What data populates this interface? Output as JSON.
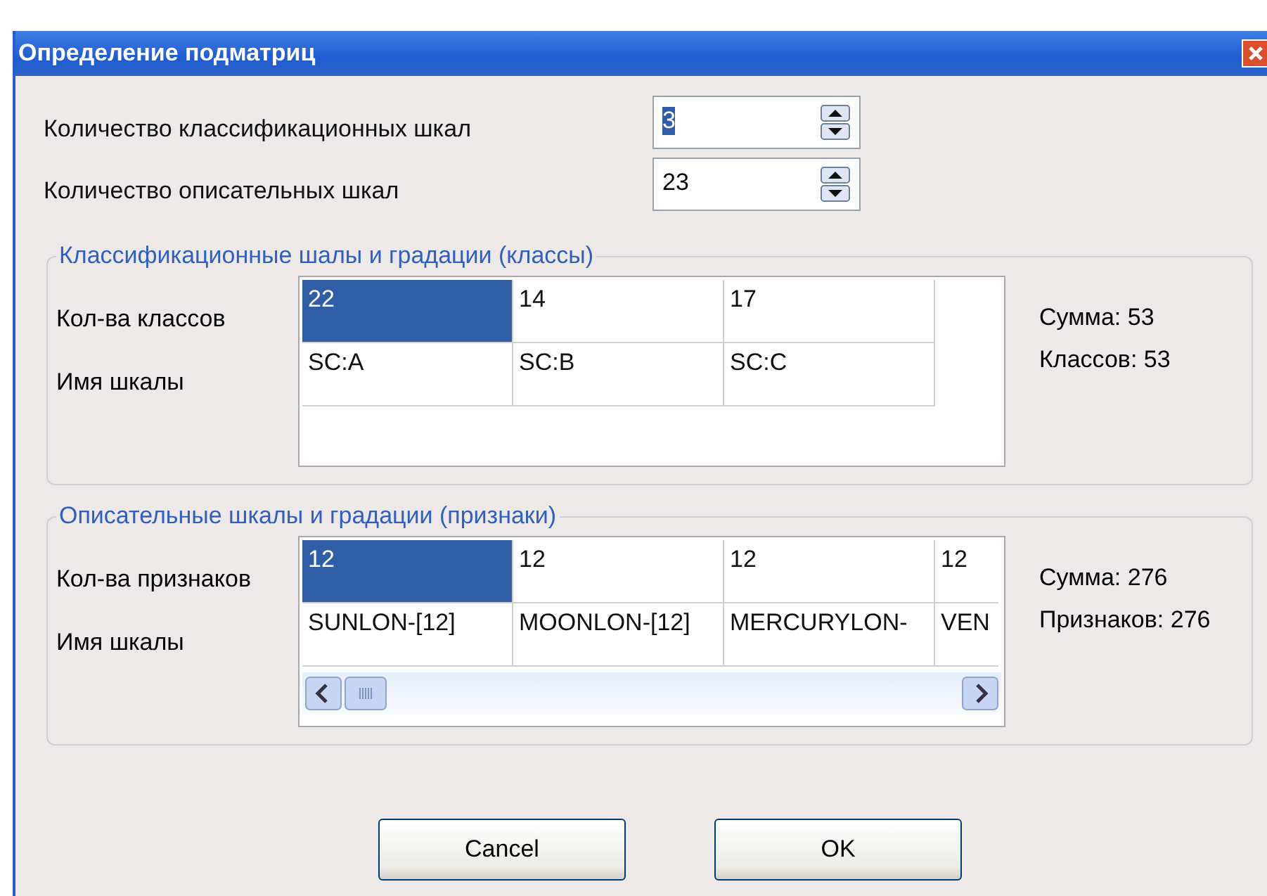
{
  "window": {
    "title": "Определение подматриц"
  },
  "spinners": [
    {
      "label": "Количество классификационных шкал",
      "value": "3",
      "text_selected": true
    },
    {
      "label": "Количество описательных шкал",
      "value": "23",
      "text_selected": false
    }
  ],
  "groups": [
    {
      "title": "Классификационные шалы и градации (классы)",
      "kind": "fixed",
      "rows": [
        {
          "label": "Кол-ва классов",
          "cells": [
            {
              "text": "22",
              "selected": true
            },
            {
              "text": "14",
              "selected": false
            },
            {
              "text": "17",
              "selected": false
            }
          ]
        },
        {
          "label": "Имя шкалы",
          "cells": [
            {
              "text": "SC:A",
              "selected": false
            },
            {
              "text": "SC:B",
              "selected": false
            },
            {
              "text": "SC:C",
              "selected": false
            }
          ]
        }
      ],
      "summary": [
        "Сумма: 53",
        "Классов: 53"
      ]
    },
    {
      "title": "Описательные шкалы и градации (признаки)",
      "kind": "scrolling",
      "rows": [
        {
          "label": "Кол-ва признаков",
          "cells": [
            {
              "text": "12",
              "selected": true
            },
            {
              "text": "12",
              "selected": false
            },
            {
              "text": "12",
              "selected": false
            },
            {
              "text": "12",
              "selected": false
            }
          ]
        },
        {
          "label": "Имя шкалы",
          "cells": [
            {
              "text": "SUNLON-[12]",
              "selected": false
            },
            {
              "text": "MOONLON-[12]",
              "selected": false
            },
            {
              "text": "MERCURYLON-",
              "selected": false
            },
            {
              "text": "VEN",
              "selected": false
            }
          ]
        }
      ],
      "summary": [
        "Сумма: 276",
        "Признаков: 276"
      ]
    }
  ],
  "buttons": [
    "Cancel",
    "OK"
  ]
}
